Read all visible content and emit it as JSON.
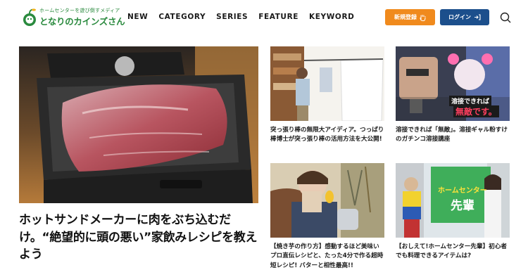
{
  "header": {
    "logo_tagline": "ホームセンターを遊び倒すメディア",
    "logo_name": "となりのカインズさん",
    "nav": [
      {
        "label": "NEW"
      },
      {
        "label": "CATEGORY"
      },
      {
        "label": "SERIES"
      },
      {
        "label": "FEATURE"
      },
      {
        "label": "KEYWORD"
      }
    ],
    "register_label": "新規登録",
    "login_label": "ログイン",
    "colors": {
      "brand": "#2a8a3e",
      "register": "#f08a1d",
      "login": "#1c4f8c"
    }
  },
  "feature": {
    "title": "ホットサンドメーカーに肉をぶち込むだけ。“絶望的に頭の悪い”家飲みレシピを教えよう"
  },
  "cards": [
    {
      "title": "突っ張り棒の無限大アイディア。つっぱり棒博士が突っ張り棒の活用方法を大公開!"
    },
    {
      "title": "溶接できれば「無敵」。溶接ギャル粉すけのガチンコ溶接講座",
      "overlay_line1": "溶接できれば",
      "overlay_line2": "無敵です。"
    },
    {
      "title": "【焼き芋の作り方】感動するほど美味いプロ直伝レシピと、たった4分で作る超時短レシピ! バターと相性最高!!"
    },
    {
      "title": "【おしえて!ホームセンター先輩】初心者でも料理できるアイテムは?",
      "overlay_line1": "ホームセンター",
      "overlay_line2": "先輩"
    }
  ]
}
